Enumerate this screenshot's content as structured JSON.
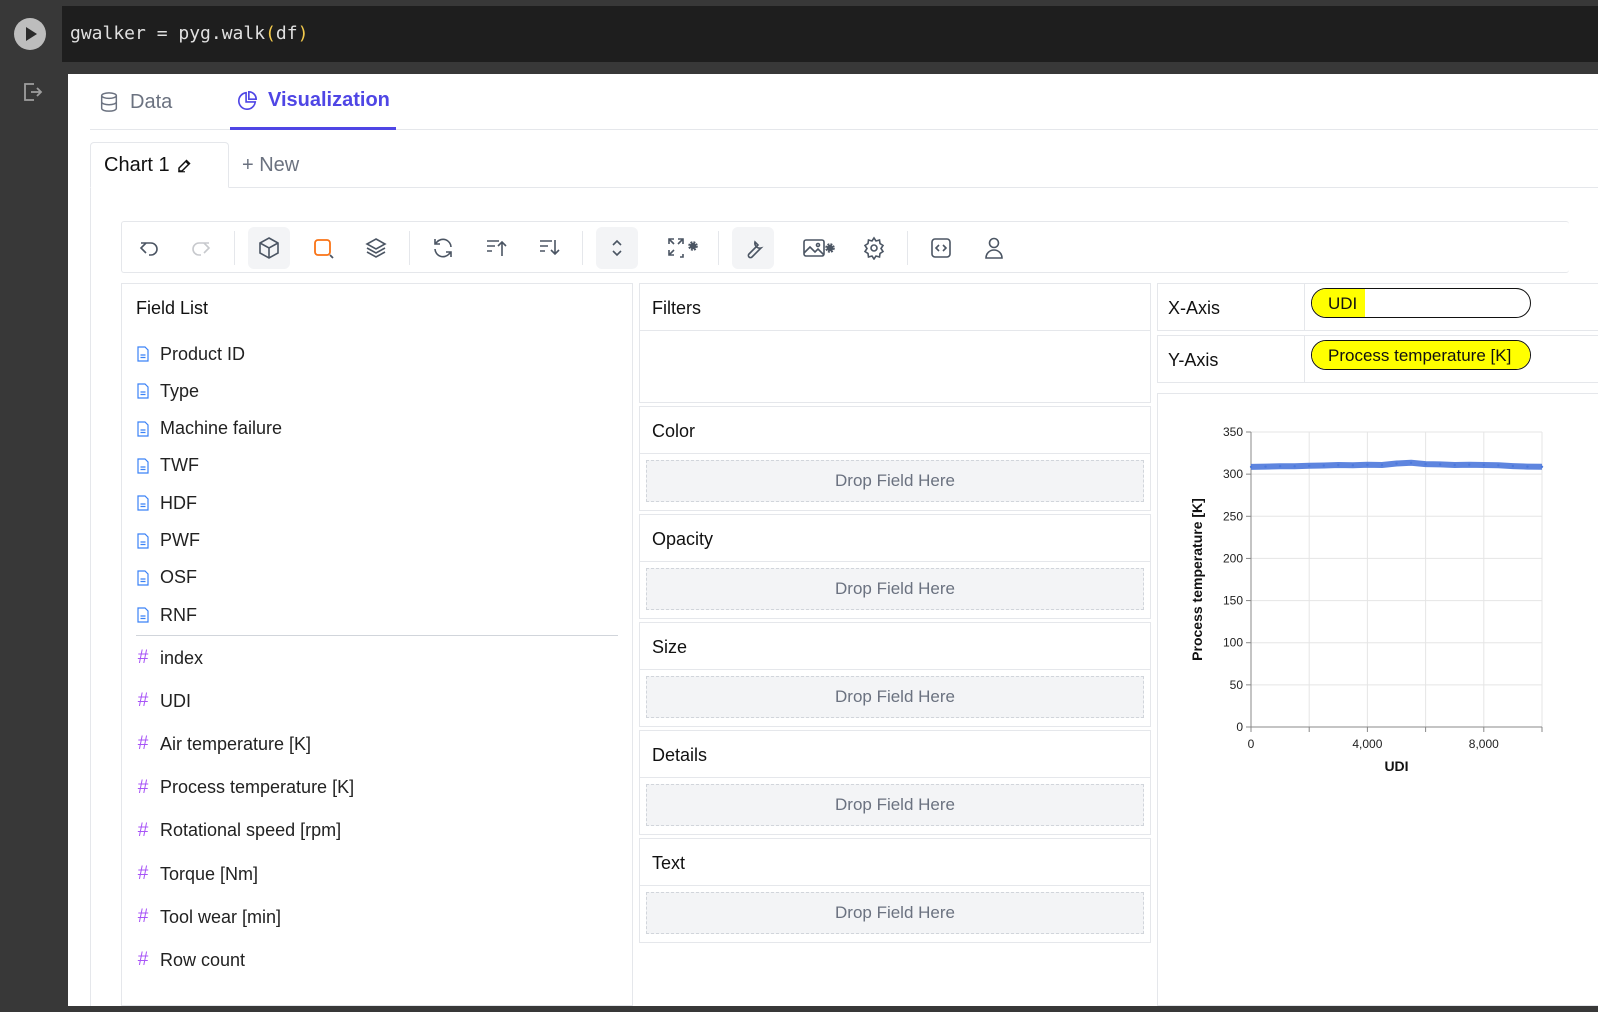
{
  "cell": {
    "code_pre": "gwalker = pyg.walk",
    "code_open": "(",
    "code_arg": "df",
    "code_close": ")"
  },
  "tabs": {
    "data": "Data",
    "visualization": "Visualization"
  },
  "chart_tabs": {
    "current": "Chart 1",
    "new": "+ New"
  },
  "field_list": {
    "title": "Field List",
    "dimensions": [
      "Product ID",
      "Type",
      "Machine failure",
      "TWF",
      "HDF",
      "PWF",
      "OSF",
      "RNF"
    ],
    "measures": [
      "index",
      "UDI",
      "Air temperature [K]",
      "Process temperature [K]",
      "Rotational speed [rpm]",
      "Torque [Nm]",
      "Tool wear [min]",
      "Row count"
    ]
  },
  "shelves": {
    "filters": "Filters",
    "color": "Color",
    "opacity": "Opacity",
    "size": "Size",
    "details": "Details",
    "text": "Text",
    "drop_hint": "Drop Field Here"
  },
  "encodings": {
    "x_label": "X-Axis",
    "x_field": "UDI",
    "y_label": "Y-Axis",
    "y_field": "Process temperature [K]"
  },
  "colors": {
    "accent": "#4f46e5",
    "highlight": "#ffff00",
    "series": "#4c78db"
  },
  "chart_data": {
    "type": "line",
    "xlabel": "UDI",
    "ylabel": "Process temperature [K]",
    "xlim": [
      0,
      10000
    ],
    "ylim": [
      0,
      350
    ],
    "xticks": [
      0,
      4000,
      8000
    ],
    "xtick_labels": [
      "0",
      "4,000",
      "8,000"
    ],
    "yticks": [
      0,
      50,
      100,
      150,
      200,
      250,
      300,
      350
    ],
    "x": [
      1,
      500,
      1000,
      1500,
      2000,
      2500,
      3000,
      3500,
      4000,
      4500,
      5000,
      5500,
      6000,
      6500,
      7000,
      7500,
      8000,
      8500,
      9000,
      9500,
      10000
    ],
    "y": [
      308.6,
      308.9,
      309.4,
      309.3,
      309.9,
      310.2,
      310.8,
      310.5,
      311.1,
      310.9,
      312.6,
      313.4,
      311.9,
      311.6,
      310.9,
      311.2,
      310.8,
      310.5,
      309.6,
      308.9,
      308.7
    ]
  }
}
